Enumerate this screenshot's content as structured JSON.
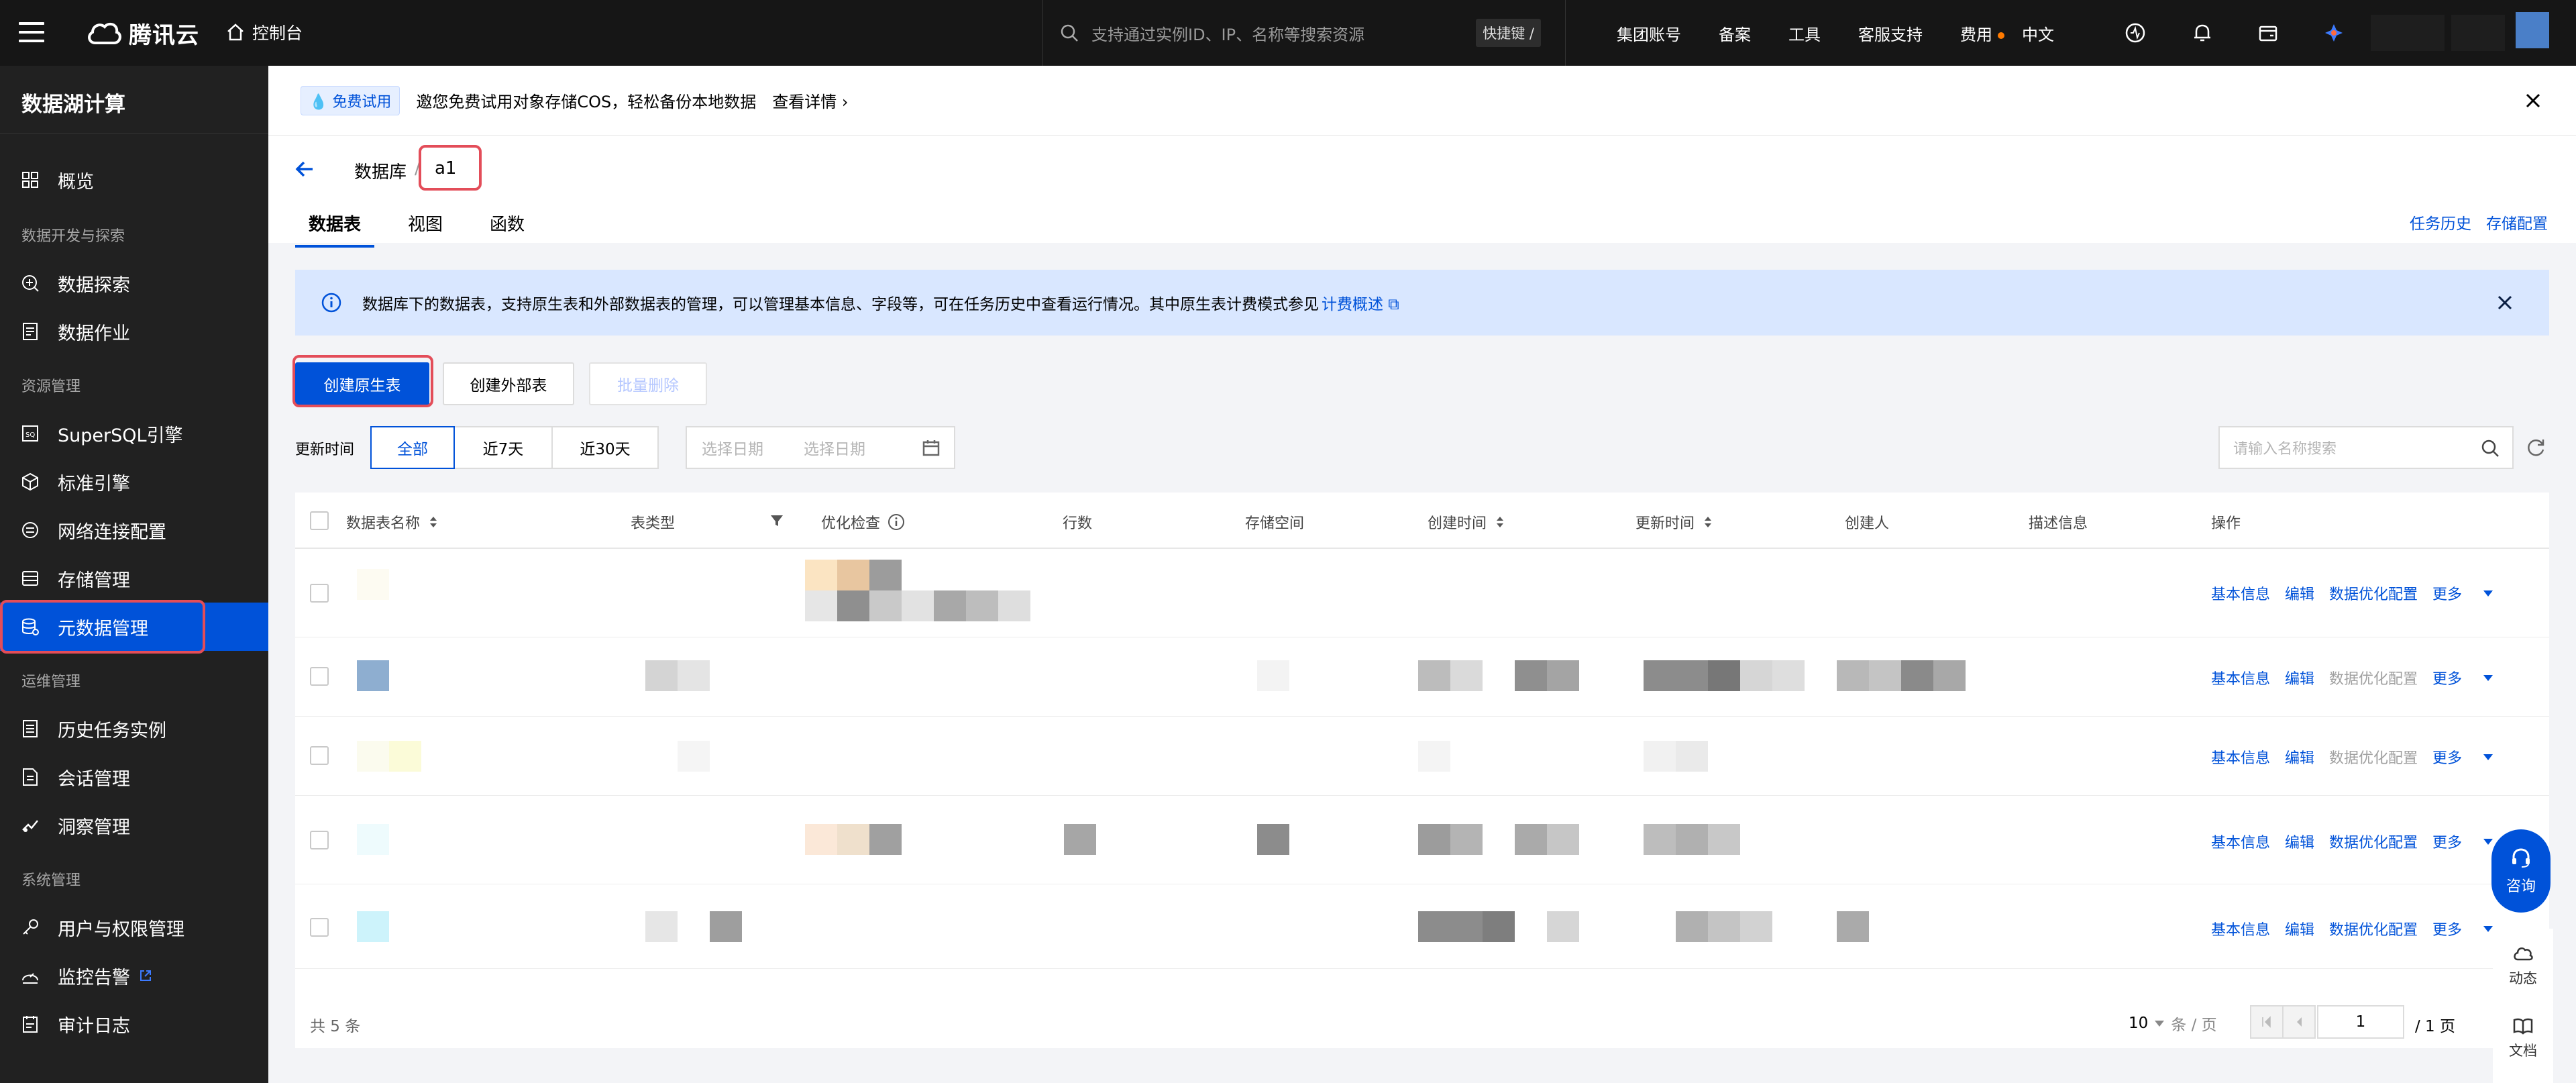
{
  "topbar": {
    "brand": "腾讯云",
    "console": "控制台",
    "search_placeholder": "支持通过实例ID、IP、名称等搜索资源",
    "shortcut": "快捷键 /",
    "nav": [
      "集团账号",
      "备案",
      "工具",
      "客服支持",
      "费用",
      "中文"
    ]
  },
  "sidebar": {
    "title": "数据湖计算",
    "items": [
      {
        "type": "item",
        "label": "概览",
        "icon": "grid-icon"
      },
      {
        "type": "group",
        "label": "数据开发与探索"
      },
      {
        "type": "item",
        "label": "数据探索",
        "icon": "explore-icon"
      },
      {
        "type": "item",
        "label": "数据作业",
        "icon": "job-icon"
      },
      {
        "type": "group",
        "label": "资源管理"
      },
      {
        "type": "item",
        "label": "SuperSQL引擎",
        "icon": "sql-icon"
      },
      {
        "type": "item",
        "label": "标准引擎",
        "icon": "cube-icon"
      },
      {
        "type": "item",
        "label": "网络连接配置",
        "icon": "network-icon"
      },
      {
        "type": "item",
        "label": "存储管理",
        "icon": "storage-icon"
      },
      {
        "type": "item",
        "label": "元数据管理",
        "icon": "metadata-icon",
        "active": true
      },
      {
        "type": "group",
        "label": "运维管理"
      },
      {
        "type": "item",
        "label": "历史任务实例",
        "icon": "history-icon"
      },
      {
        "type": "item",
        "label": "会话管理",
        "icon": "session-icon"
      },
      {
        "type": "item",
        "label": "洞察管理",
        "icon": "insight-icon"
      },
      {
        "type": "group",
        "label": "系统管理"
      },
      {
        "type": "item",
        "label": "用户与权限管理",
        "icon": "key-icon"
      },
      {
        "type": "item",
        "label": "监控告警",
        "icon": "monitor-icon",
        "external": true
      },
      {
        "type": "item",
        "label": "审计日志",
        "icon": "audit-icon"
      }
    ]
  },
  "promo": {
    "tag": "免费试用",
    "text": "邀您免费试用对象存储COS，轻松备份本地数据",
    "link": "查看详情"
  },
  "header": {
    "db_label": "数据库",
    "separator": "/",
    "db_name": "a1",
    "tabs": [
      "数据表",
      "视图",
      "函数"
    ],
    "links": [
      "任务历史",
      "存储配置"
    ]
  },
  "notice": {
    "text": "数据库下的数据表，支持原生表和外部数据表的管理，可以管理基本信息、字段等，可在任务历史中查看运行情况。其中原生表计费模式参见",
    "link": "计费概述"
  },
  "toolbar": {
    "create_native": "创建原生表",
    "create_external": "创建外部表",
    "batch_delete": "批量删除",
    "filter_label": "更新时间",
    "segments": [
      "全部",
      "近7天",
      "近30天"
    ],
    "date_start": "选择日期",
    "date_end": "选择日期",
    "search_placeholder": "请输入名称搜索"
  },
  "table": {
    "columns": [
      "数据表名称",
      "表类型",
      "优化检查",
      "行数",
      "存储空间",
      "创建时间",
      "更新时间",
      "创建人",
      "描述信息",
      "操作"
    ],
    "rows": [
      {
        "ops": [
          "基本信息",
          "编辑",
          "数据优化配置",
          "更多"
        ],
        "opt_enabled": true
      },
      {
        "ops": [
          "基本信息",
          "编辑",
          "数据优化配置",
          "更多"
        ],
        "opt_enabled": false
      },
      {
        "ops": [
          "基本信息",
          "编辑",
          "数据优化配置",
          "更多"
        ],
        "opt_enabled": false
      },
      {
        "ops": [
          "基本信息",
          "编辑",
          "数据优化配置",
          "更多"
        ],
        "opt_enabled": true
      },
      {
        "ops": [
          "基本信息",
          "编辑",
          "数据优化配置",
          "更多"
        ],
        "opt_enabled": true
      }
    ]
  },
  "pager": {
    "total": "共 5 条",
    "page_size": "10",
    "page_size_unit": "条 / 页",
    "current": "1",
    "pages": "/ 1 页"
  },
  "float": {
    "consult": "咨询",
    "dynamic": "动态",
    "docs": "文档"
  },
  "colors": {
    "primary": "#0052d9",
    "topbar": "#161616",
    "sidebar": "#212121",
    "notice": "#d9e7ff",
    "highlight": "#e34d59"
  }
}
